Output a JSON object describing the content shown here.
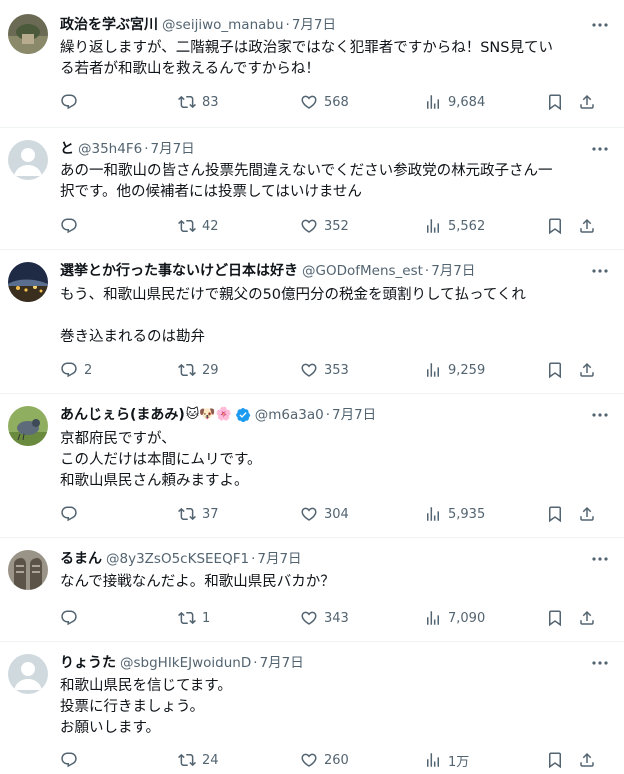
{
  "tweets": [
    {
      "name": "政治を学ぶ宮川",
      "emojis": "",
      "verified": false,
      "handle": "@seijiwo_manabu",
      "date": "7月7日",
      "lines": [
        "繰り返しますが、二階親子は政治家ではなく犯罪者ですからね！SNS見てい",
        "る若者が和歌山を救えるんですからね！"
      ],
      "replies": "",
      "retweets": "83",
      "likes": "568",
      "views": "9,684"
    },
    {
      "name": "と",
      "emojis": "",
      "verified": false,
      "handle": "@35h4F6",
      "date": "7月7日",
      "lines": [
        "あの一和歌山の皆さん投票先間違えないでください参政党の林元政子さん一",
        "択です。他の候補者には投票してはいけません"
      ],
      "replies": "",
      "retweets": "42",
      "likes": "352",
      "views": "5,562"
    },
    {
      "name": "選挙とか行った事ないけど日本は好き",
      "emojis": "",
      "verified": false,
      "handle": "@GODofMens_est",
      "date": "7月7日",
      "lines": [
        "もう、和歌山県民だけで親父の50億円分の税金を頭割りして払ってくれ",
        "",
        "巻き込まれるのは勘弁"
      ],
      "replies": "2",
      "retweets": "29",
      "likes": "353",
      "views": "9,259"
    },
    {
      "name": "あんじぇら(まあみ)",
      "emojis": "🐱🐶🌸",
      "verified": true,
      "handle": "@m6a3a0",
      "date": "7月7日",
      "lines": [
        "京都府民ですが、",
        "この人だけは本間にムリです。",
        "和歌山県民さん頼みますよ。"
      ],
      "replies": "",
      "retweets": "37",
      "likes": "304",
      "views": "5,935"
    },
    {
      "name": "るまん",
      "emojis": "",
      "verified": false,
      "handle": "@8y3ZsO5cKSEEQF1",
      "date": "7月7日",
      "lines": [
        "なんで接戦なんだよ。和歌山県民バカか？"
      ],
      "replies": "",
      "retweets": "1",
      "likes": "343",
      "views": "7,090"
    },
    {
      "name": "りょうた",
      "emojis": "",
      "verified": false,
      "handle": "@sbgHIkEJwoidunD",
      "date": "7月7日",
      "lines": [
        "和歌山県民を信じてます。",
        "投票に行きましょう。",
        "お願いします。"
      ],
      "replies": "",
      "retweets": "24",
      "likes": "260",
      "views": "1万"
    }
  ],
  "separator": "·",
  "colors": {
    "text": "#0f1419",
    "secondary": "#536471",
    "verified": "#1d9bf0",
    "divider": "#eff3f4"
  },
  "icons": [
    "reply-icon",
    "retweet-icon",
    "like-icon",
    "views-icon",
    "bookmark-icon",
    "share-icon",
    "more-icon",
    "verified-badge-icon"
  ]
}
